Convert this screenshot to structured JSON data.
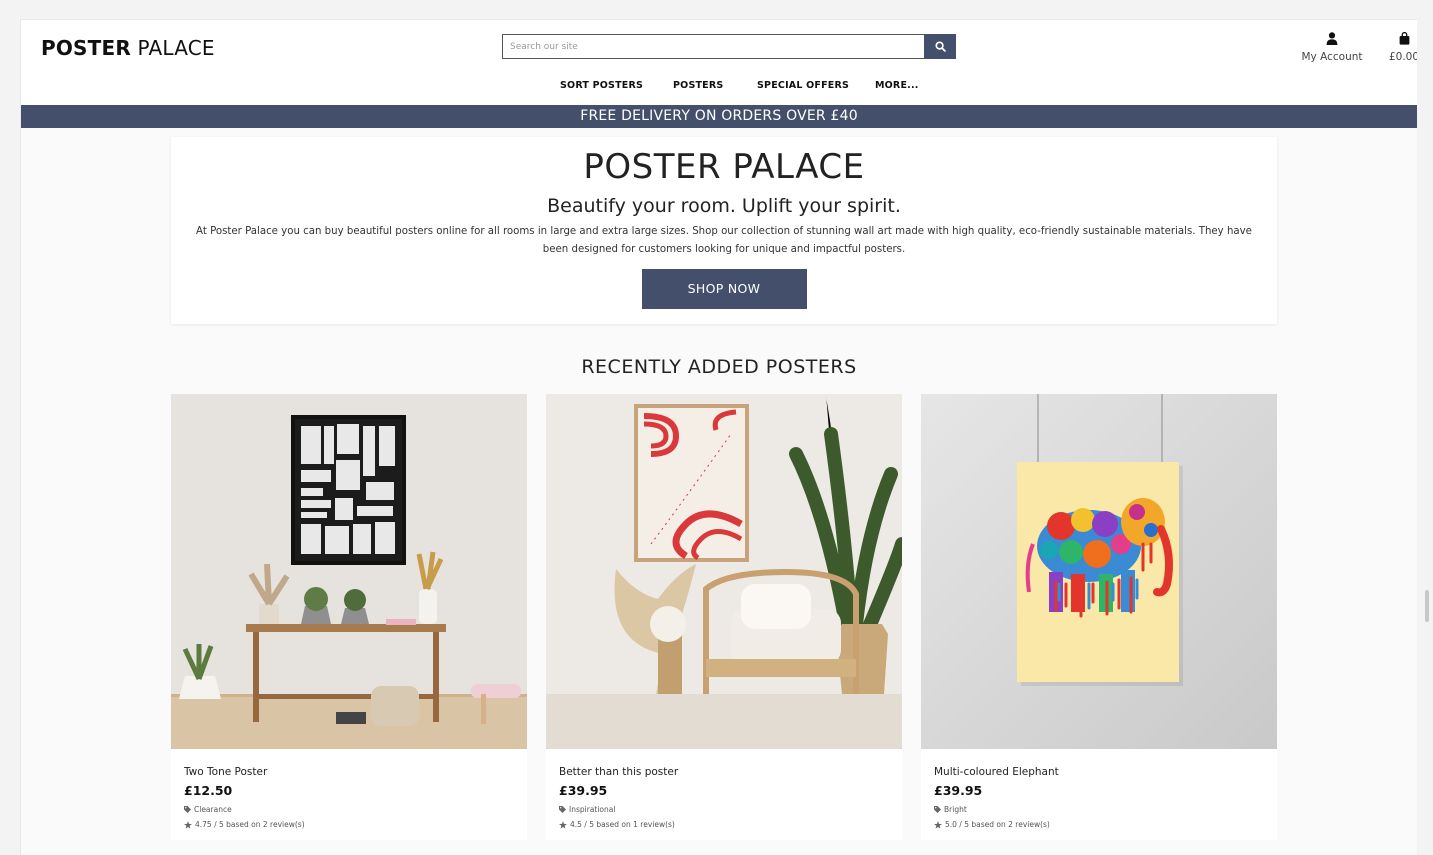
{
  "header": {
    "logo_bold": "POSTER",
    "logo_light": "PALACE",
    "search_placeholder": "Search our site",
    "account_label": "My Account",
    "bag_total": "£0.00"
  },
  "nav": {
    "items": [
      {
        "label": "SORT POSTERS"
      },
      {
        "label": "POSTERS"
      },
      {
        "label": "SPECIAL OFFERS"
      },
      {
        "label": "MORE..."
      }
    ]
  },
  "banner": {
    "text": "FREE DELIVERY ON ORDERS OVER £40"
  },
  "hero": {
    "title": "POSTER PALACE",
    "subtitle": "Beautify your room. Uplift your spirit.",
    "body": "At Poster Palace you can buy beautiful posters online for all rooms in large and extra large sizes. Shop our collection of stunning wall art made with high quality, eco-friendly sustainable materials. They have been designed for customers looking for unique and impactful posters.",
    "button": "SHOP NOW"
  },
  "recent": {
    "title": "RECENTLY ADDED POSTERS",
    "products": [
      {
        "name": "Two Tone Poster",
        "price": "£12.50",
        "category": "Clearance",
        "rating": "4.75 / 5 based on 2 review(s)"
      },
      {
        "name": "Better than this poster",
        "price": "£39.95",
        "category": "Inspirational",
        "rating": "4.5 / 5 based on 1 review(s)"
      },
      {
        "name": "Multi-coloured Elephant",
        "price": "£39.95",
        "category": "Bright",
        "rating": "5.0 / 5 based on 2 review(s)"
      }
    ]
  },
  "colors": {
    "primary": "#44506b",
    "background": "#fafafa"
  }
}
